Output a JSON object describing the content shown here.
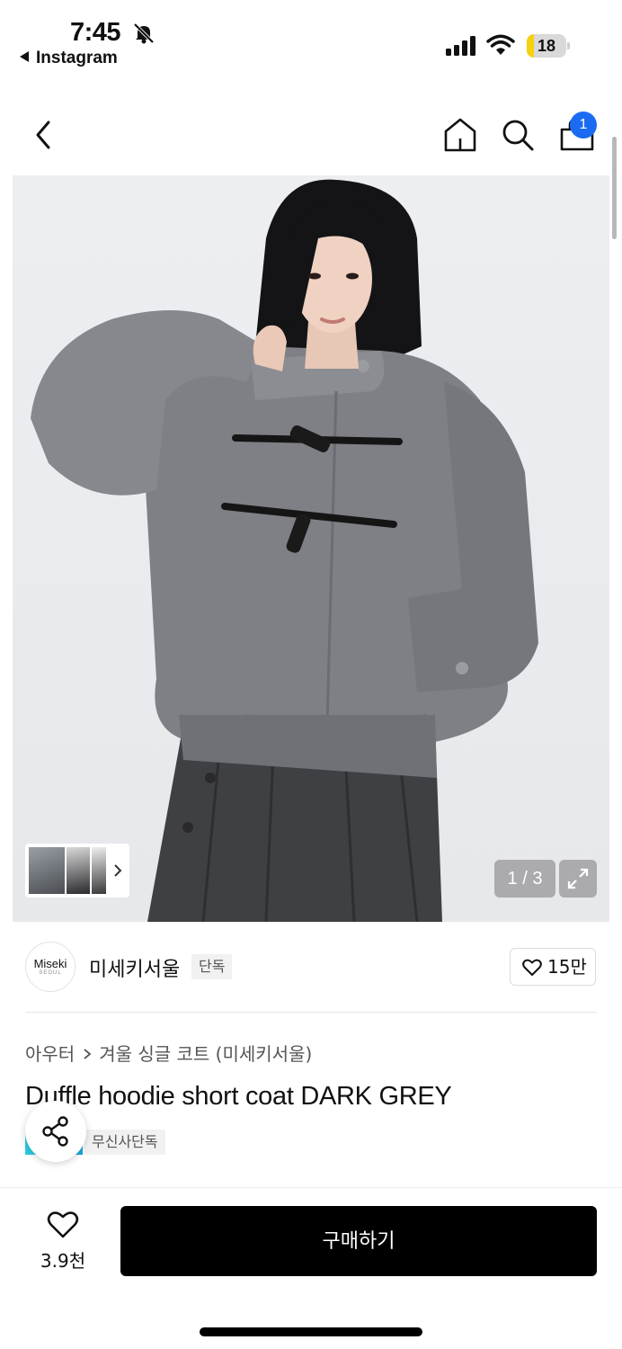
{
  "status_bar": {
    "time": "7:45",
    "back_app": "Instagram",
    "battery": "18",
    "battery_level": 0.18
  },
  "nav": {
    "cart_count": "1"
  },
  "gallery": {
    "counter": "1 / 3"
  },
  "brand": {
    "logo_text": "Miseki",
    "logo_sub": "SEOUL",
    "name": "미세키서울",
    "tag": "단독",
    "likes": "15만"
  },
  "product": {
    "category": "아우터",
    "subcategory": "겨울 싱글 코트 (미세키서울)",
    "title": "Duffle hoodie short coat DARK GREY",
    "badge": "무신사단독"
  },
  "bottom_bar": {
    "wish_count": "3.9천",
    "buy_label": "구매하기"
  },
  "colors": {
    "accent_badge": "#1b6bf2",
    "battery_fill": "#f5d10f",
    "buy_button": "#000000"
  }
}
